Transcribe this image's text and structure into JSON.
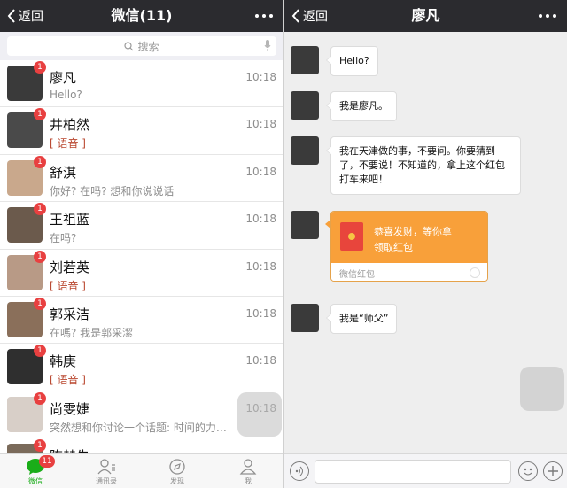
{
  "left": {
    "header": {
      "back_label": "返回",
      "title": "微信(11)"
    },
    "search": {
      "placeholder": "搜索"
    },
    "chats": [
      {
        "name": "廖凡",
        "time": "10:18",
        "preview": "Hello?",
        "badge": "1",
        "preview_style": "text",
        "avatar_color": "#3a3a3a"
      },
      {
        "name": "井柏然",
        "time": "10:18",
        "preview": "[ 语音 ]",
        "badge": "1",
        "preview_style": "voice",
        "avatar_color": "#4a4a4a"
      },
      {
        "name": "舒淇",
        "time": "10:18",
        "preview": "你好? 在吗? 想和你说说话",
        "badge": "1",
        "preview_style": "text",
        "avatar_color": "#c9a88c"
      },
      {
        "name": "王祖蓝",
        "time": "10:18",
        "preview": "在吗?",
        "badge": "1",
        "preview_style": "text",
        "avatar_color": "#6b5a4c"
      },
      {
        "name": "刘若英",
        "time": "10:18",
        "preview": "[ 语音 ]",
        "badge": "1",
        "preview_style": "voice",
        "avatar_color": "#b89a86"
      },
      {
        "name": "郭采洁",
        "time": "10:18",
        "preview": "在嗎? 我是郭采潔",
        "badge": "1",
        "preview_style": "text",
        "avatar_color": "#8a6f5a"
      },
      {
        "name": "韩庚",
        "time": "10:18",
        "preview": "[ 语音 ]",
        "badge": "1",
        "preview_style": "voice",
        "avatar_color": "#2f2f2f"
      },
      {
        "name": "尚雯婕",
        "time": "10:18",
        "preview": "突然想和你讨论一个话题: 时间的力量....",
        "badge": "1",
        "preview_style": "text",
        "avatar_color": "#d8cfc8"
      },
      {
        "name": "陈赫先",
        "time": "",
        "preview": "",
        "badge": "1",
        "preview_style": "text",
        "avatar_color": "#7a6a5a"
      }
    ],
    "tabbar": {
      "tabs": [
        {
          "label": "微信",
          "icon": "chat-bubble-icon",
          "badge": "11",
          "active": true
        },
        {
          "label": "通讯录",
          "icon": "contacts-icon"
        },
        {
          "label": "发现",
          "icon": "compass-icon"
        },
        {
          "label": "我",
          "icon": "person-icon"
        }
      ],
      "active_color": "#1aad19"
    }
  },
  "right": {
    "header": {
      "back_label": "返回",
      "title": "廖凡"
    },
    "messages": [
      {
        "type": "text",
        "text": "Hello?"
      },
      {
        "type": "text",
        "text": "我是廖凡。"
      },
      {
        "type": "text",
        "text": "我在天津做的事，不要问。你要猜到了，不要说！不知道的，拿上这个红包打车来吧！"
      },
      {
        "type": "red_packet",
        "greeting": "恭喜发财，等你拿",
        "action": "领取红包",
        "label": "微信红包"
      },
      {
        "type": "text",
        "text": "我是“师父”"
      }
    ],
    "input": {
      "placeholder": ""
    }
  },
  "colors": {
    "topbar": "#2b2b2f",
    "badge": "#e84040",
    "red_packet": "#f8a03a",
    "chat_bg": "#eeeeee"
  }
}
